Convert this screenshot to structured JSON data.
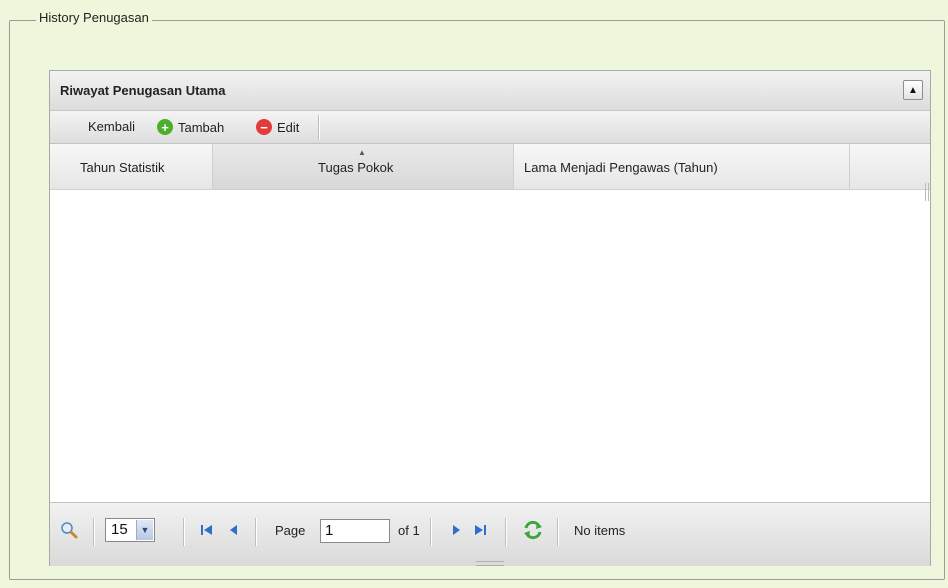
{
  "fieldset": {
    "legend": "History Penugasan"
  },
  "panel": {
    "title": "Riwayat Penugasan Utama",
    "collapse_icon": "▲"
  },
  "toolbar": {
    "back_label": "Kembali",
    "add_label": "Tambah",
    "edit_label": "Edit",
    "add_icon": "plus-circle-icon",
    "edit_icon": "minus-circle-icon",
    "colors": {
      "add": "#4caf2b",
      "edit": "#e23b3b"
    }
  },
  "grid": {
    "columns": [
      "Tahun Statistik",
      "Tugas Pokok",
      "Lama Menjadi Pengawas (Tahun)",
      ""
    ],
    "sorted_column": "Tugas Pokok",
    "rows": []
  },
  "pager": {
    "page_size": "15",
    "page_label": "Page",
    "page_value": "1",
    "of_label": "of 1",
    "status": "No items",
    "icons": [
      "search-icon",
      "first-page-icon",
      "prev-page-icon",
      "next-page-icon",
      "last-page-icon",
      "refresh-icon"
    ]
  }
}
